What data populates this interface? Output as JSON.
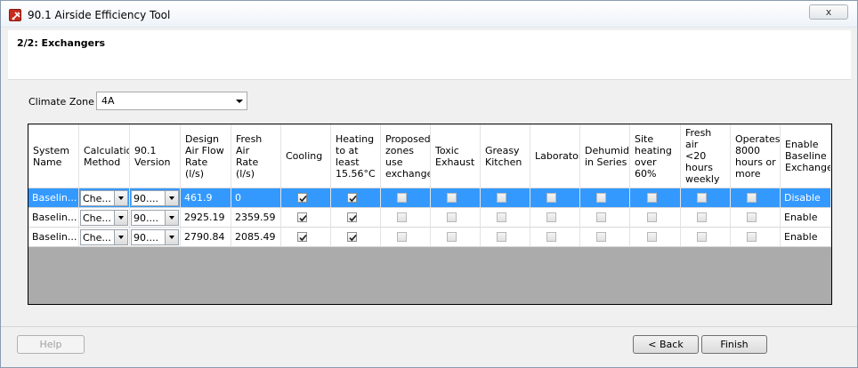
{
  "window": {
    "title": "90.1 Airside Efficiency Tool",
    "close_label": "x"
  },
  "header": {
    "step_title": "2/2: Exchangers"
  },
  "climate": {
    "label": "Climate Zone",
    "value": "4A"
  },
  "grid": {
    "columns": [
      "System\nName",
      "Calculation\nMethod",
      "90.1\nVersion",
      "Design\nAir Flow\nRate\n(l/s)",
      "Fresh Air\nRate (l/s)",
      "Cooling",
      "Heating\nto at\nleast\n15.56°C",
      "Proposed\nzones\nuse\nexchanger",
      "Toxic\nExhaust",
      "Greasy\nKitchen",
      "Laboratory",
      "Dehumidifi\nin Series",
      "Site\nheating\nover\n60%",
      "Fresh air\n<20\nhours\nweekly",
      "Operates\n8000\nhours or\nmore",
      "Enable\nBaseline\nExchanger"
    ],
    "rows": [
      {
        "name": "Baselin...",
        "method": "Che...",
        "version": "90....",
        "design_flow": "461.9",
        "fresh_flow": "0",
        "cooling": true,
        "heating": true,
        "enable": "Disable",
        "selected": true
      },
      {
        "name": "Baselin...",
        "method": "Che...",
        "version": "90....",
        "design_flow": "2925.19",
        "fresh_flow": "2359.59",
        "cooling": true,
        "heating": true,
        "enable": "Enable",
        "selected": false
      },
      {
        "name": "Baselin...",
        "method": "Che...",
        "version": "90....",
        "design_flow": "2790.84",
        "fresh_flow": "2085.49",
        "cooling": true,
        "heating": true,
        "enable": "Enable",
        "selected": false
      }
    ]
  },
  "footer": {
    "help_label": "Help",
    "back_label": "< Back",
    "finish_label": "Finish"
  },
  "colors": {
    "selection": "#3399ff",
    "grid_background": "#ababab",
    "app_icon": "#c62b1f"
  }
}
